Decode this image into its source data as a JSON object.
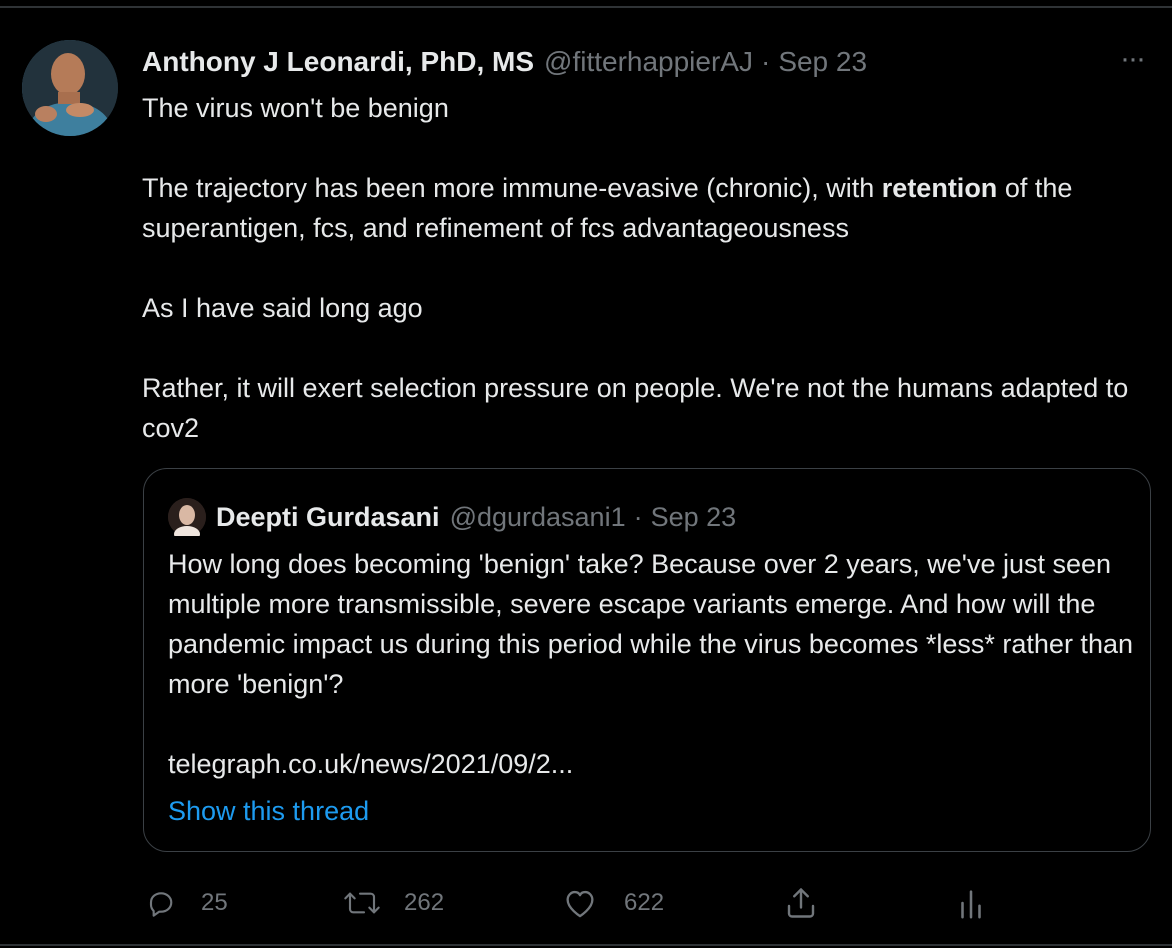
{
  "tweet": {
    "author_name": "Anthony J Leonardi, PhD, MS",
    "handle": "@fitterhappierAJ",
    "separator": "·",
    "date": "Sep 23",
    "more_label": "···",
    "paragraphs": {
      "p1": "The virus won't be benign",
      "p2_before": "The trajectory has been more immune-evasive (chronic), with ",
      "p2_bold": "retention",
      "p2_after": " of the superantigen, fcs, and refinement of fcs advantageousness",
      "p3": "As I have said long ago",
      "p4": "Rather, it will exert selection pressure on people. We're not the humans adapted to cov2"
    }
  },
  "quoted": {
    "author_name": "Deepti Gurdasani",
    "handle": "@dgurdasani1",
    "separator": "·",
    "date": "Sep 23",
    "text": "How long does becoming 'benign' take? Because over 2 years, we've just seen multiple more transmissible, severe escape variants emerge. And how will the pandemic impact us during this period while the virus becomes *less* rather than more 'benign'?",
    "link": "telegraph.co.uk/news/2021/09/2...",
    "show_thread": "Show this thread"
  },
  "actions": {
    "reply_count": "25",
    "retweet_count": "262",
    "like_count": "622"
  },
  "colors": {
    "background": "#000000",
    "text": "#e7e9ea",
    "muted": "#71767b",
    "link": "#1d9bf0",
    "border": "#3b4045"
  },
  "icons": [
    "reply-icon",
    "retweet-icon",
    "like-icon",
    "share-icon",
    "analytics-icon",
    "more-icon"
  ]
}
